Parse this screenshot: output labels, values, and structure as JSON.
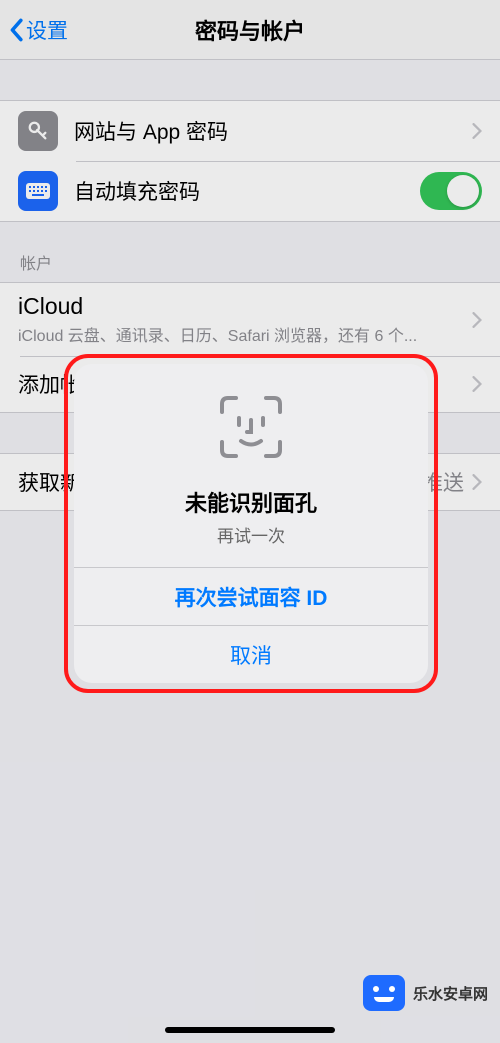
{
  "header": {
    "back": "设置",
    "title": "密码与帐户"
  },
  "section1": {
    "passwords": "网站与 App 密码",
    "autofill": "自动填充密码"
  },
  "accounts": {
    "header": "帐户",
    "icloud": {
      "title": "iCloud",
      "subtitle": "iCloud 云盘、通讯录、日历、Safari 浏览器，还有 6 个..."
    },
    "add": "添加帐户"
  },
  "fetch": {
    "label_prefix": "获取新",
    "value": "推送"
  },
  "alert": {
    "title": "未能识别面孔",
    "message": "再试一次",
    "retry": "再次尝试面容 ID",
    "cancel": "取消"
  },
  "watermark": "乐水安卓网"
}
